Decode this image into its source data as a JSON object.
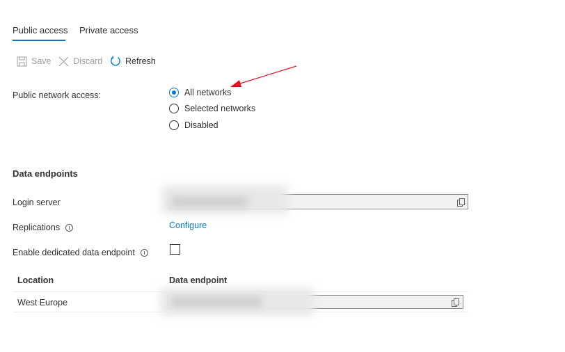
{
  "tabs": [
    {
      "label": "Public access",
      "active": true
    },
    {
      "label": "Private access",
      "active": false
    }
  ],
  "toolbar": {
    "save_label": "Save",
    "discard_label": "Discard",
    "refresh_label": "Refresh"
  },
  "network": {
    "label": "Public network access:",
    "options": [
      {
        "label": "All networks",
        "selected": true
      },
      {
        "label": "Selected networks",
        "selected": false
      },
      {
        "label": "Disabled",
        "selected": false
      }
    ]
  },
  "data_endpoints": {
    "title": "Data endpoints",
    "login_server_label": "Login server",
    "replications_label": "Replications",
    "configure_link": "Configure",
    "dedicated_endpoint_label": "Enable dedicated data endpoint",
    "dedicated_endpoint_checked": false
  },
  "table": {
    "columns": [
      "Location",
      "Data endpoint"
    ],
    "rows": [
      {
        "location": "West Europe"
      }
    ]
  },
  "colors": {
    "accent": "#0078d4",
    "annotation_arrow": "#e81123"
  }
}
